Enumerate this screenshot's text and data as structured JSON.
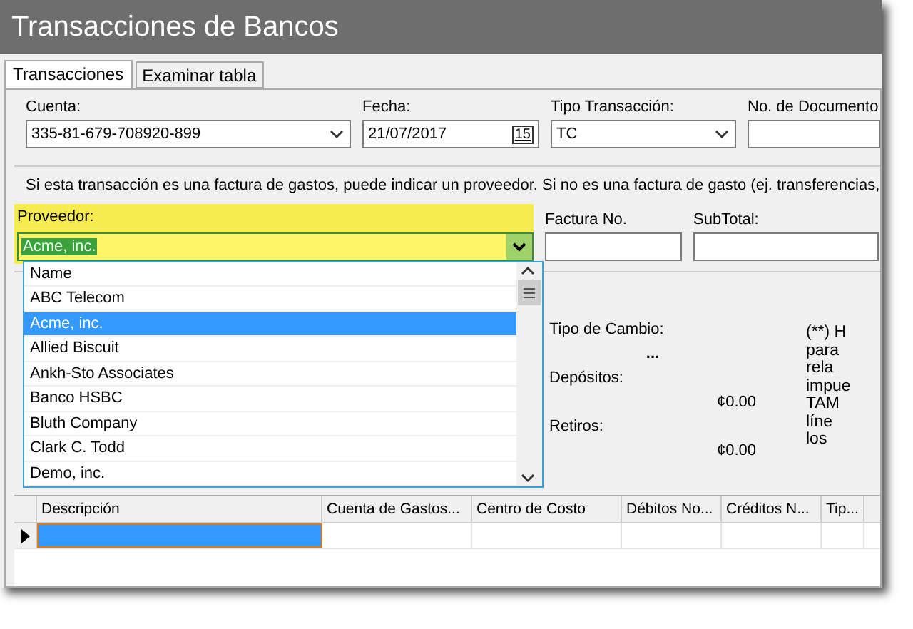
{
  "window": {
    "title": "Transacciones de Bancos"
  },
  "tabs": [
    {
      "label": "Transacciones",
      "selected": true
    },
    {
      "label": "Examinar tabla",
      "selected": false
    }
  ],
  "fields": [
    {
      "label": "Cuenta:",
      "value": "335-81-679-708920-899",
      "kind": "combo"
    },
    {
      "label": "Fecha:",
      "value": "21/07/2017",
      "kind": "date",
      "button": "15"
    },
    {
      "label": "Tipo Transacción:",
      "value": "TC",
      "kind": "combo"
    },
    {
      "label": "No. de Documento",
      "kind": "text"
    }
  ],
  "message": "Si esta transacción es una factura de gastos, puede indicar un proveedor. Si no es una factura de gasto (ej. transferencias,",
  "proveedor": {
    "label": "Proveedor:",
    "value": "Acme, inc.",
    "highlighted": true
  },
  "factura": {
    "label": "Factura No."
  },
  "subtotal": {
    "label": "SubTotal:"
  },
  "dropdown": {
    "items": [
      {
        "label": "Name",
        "selected": false
      },
      {
        "label": "ABC Telecom",
        "selected": false
      },
      {
        "label": "Acme, inc.",
        "selected": true
      },
      {
        "label": "Allied Biscuit",
        "selected": false
      },
      {
        "label": "Ankh-Sto Associates",
        "selected": false
      },
      {
        "label": "Banco HSBC",
        "selected": false
      },
      {
        "label": "Bluth Company",
        "selected": false
      },
      {
        "label": "Clark C. Todd",
        "selected": false
      },
      {
        "label": "Demo, inc.",
        "selected": false
      }
    ]
  },
  "summary": {
    "tipo_cambio": "Tipo de Cambio:",
    "ellipsis": "...",
    "depositos": "Depósitos:",
    "depositos_value": "¢0.00",
    "retiros": "Retiros:",
    "retiros_value": "¢0.00"
  },
  "note_lines": [
    "(**) H",
    "para",
    "rela",
    "impue",
    "TAM",
    "líne",
    "los"
  ],
  "grid": {
    "columns": [
      "Descripción",
      "Cuenta de Gastos...",
      "Centro de Costo",
      "Débitos No...",
      "Créditos N...",
      "Tip..."
    ]
  }
}
